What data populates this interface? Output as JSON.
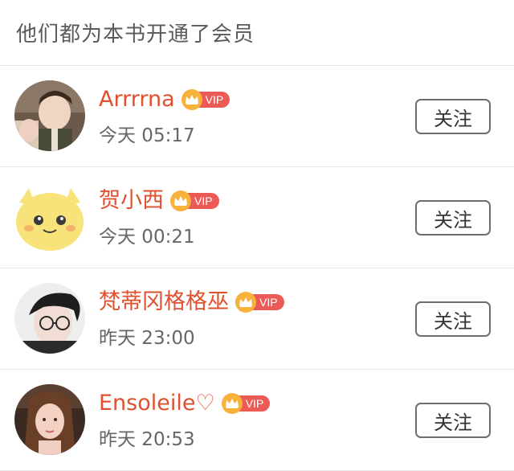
{
  "header": {
    "title": "他们都为本书开通了会员"
  },
  "vip_badge_text": "VIP",
  "follow_label": "关注",
  "colors": {
    "name": "#e0502e",
    "vip_badge": "#ec5a55",
    "crown": "#f6b23a",
    "divider": "#e6e6e6"
  },
  "members": [
    {
      "name": "Arrrrna",
      "time": "今天 05:17",
      "avatar_icon": "avatar-child-photo"
    },
    {
      "name": "贺小西",
      "time": "今天 00:21",
      "avatar_icon": "avatar-yellow-cartoon"
    },
    {
      "name": "梵蒂冈格格巫",
      "time": "昨天 23:00",
      "avatar_icon": "avatar-boy-glasses"
    },
    {
      "name": "Ensoleile♡",
      "time": "昨天 20:53",
      "avatar_icon": "avatar-girl-photo"
    }
  ]
}
